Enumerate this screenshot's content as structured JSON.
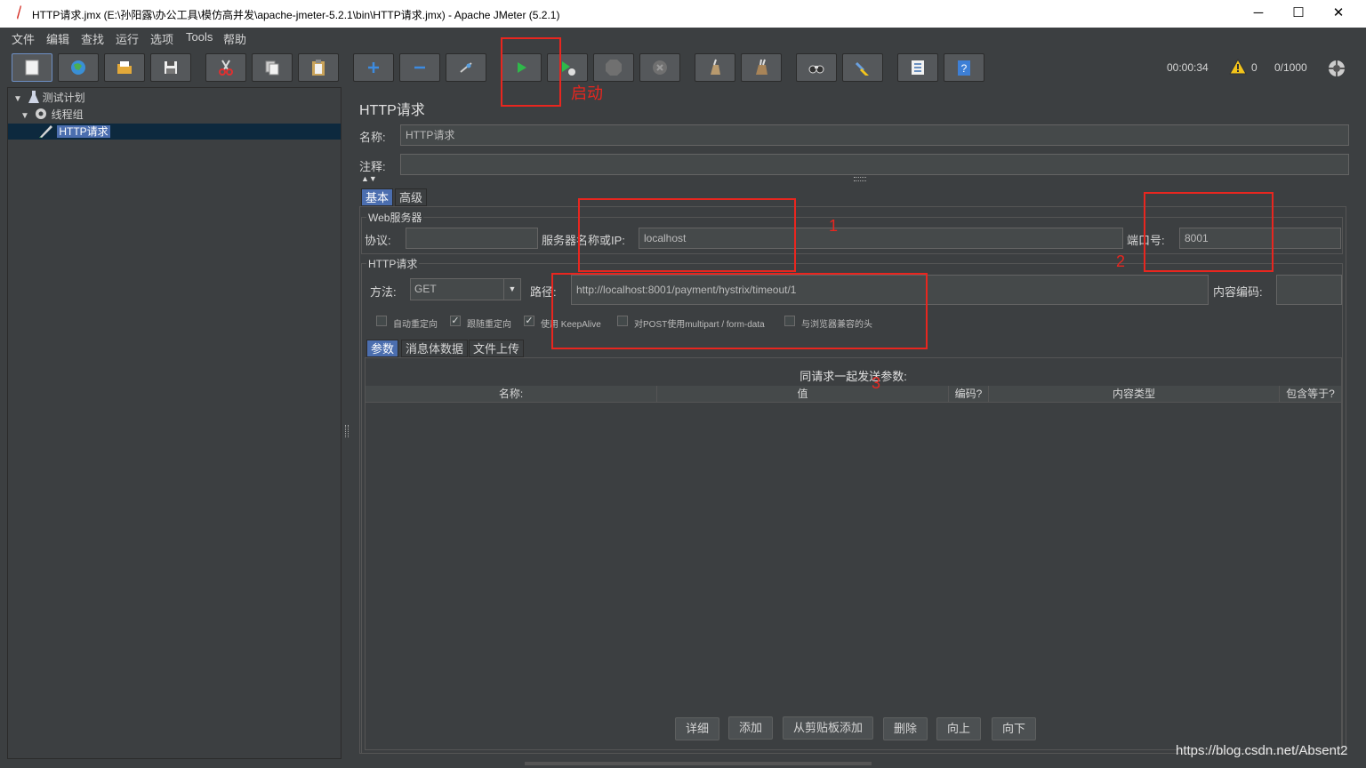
{
  "window": {
    "title": "HTTP请求.jmx (E:\\孙阳露\\办公工具\\模仿高并发\\apache-jmeter-5.2.1\\bin\\HTTP请求.jmx) - Apache JMeter (5.2.1)",
    "minimize": "─",
    "maximize": "☐",
    "close": "✕"
  },
  "menu": [
    "文件",
    "编辑",
    "查找",
    "运行",
    "选项",
    "Tools",
    "帮助"
  ],
  "toolbar": {
    "buttons": [
      "new-icon",
      "templates-icon",
      "open-icon",
      "save-icon",
      "cut-icon",
      "copy-icon",
      "paste-icon",
      "expand-icon",
      "collapse-icon",
      "toggle-icon",
      "start-icon",
      "start-no-pause-icon",
      "stop-icon",
      "shutdown-icon",
      "clear-icon",
      "clear-all-icon",
      "search-icon",
      "reset-search-icon",
      "function-helper-icon",
      "help-icon"
    ],
    "elapsed": "00:00:34",
    "warnings": "0",
    "threads": "0/1000"
  },
  "tree": {
    "items": [
      {
        "label": "测试计划"
      },
      {
        "label": "线程组"
      },
      {
        "label": "HTTP请求"
      }
    ]
  },
  "panel": {
    "title": "HTTP请求",
    "name_label": "名称:",
    "name_value": "HTTP请求",
    "comment_label": "注释:",
    "comment_value": "",
    "tabs": [
      "基本",
      "高级"
    ],
    "web_server": {
      "legend": "Web服务器",
      "protocol_label": "协议:",
      "protocol_value": "",
      "server_label": "服务器名称或IP:",
      "server_value": "localhost",
      "port_label": "端口号:",
      "port_value": "8001"
    },
    "http_request": {
      "legend": "HTTP请求",
      "method_label": "方法:",
      "method_value": "GET",
      "path_label": "路径:",
      "path_value": "http://localhost:8001/payment/hystrix/timeout/1",
      "encoding_label": "内容编码:",
      "encoding_value": "",
      "checkboxes": [
        {
          "label": "自动重定向",
          "checked": false
        },
        {
          "label": "跟随重定向",
          "checked": true
        },
        {
          "label": "使用 KeepAlive",
          "checked": true
        },
        {
          "label": "对POST使用multipart / form-data",
          "checked": false
        },
        {
          "label": "与浏览器兼容的头",
          "checked": false
        }
      ]
    },
    "sub_tabs": [
      "参数",
      "消息体数据",
      "文件上传"
    ],
    "params_title": "同请求一起发送参数:",
    "columns": [
      "名称:",
      "值",
      "编码?",
      "内容类型",
      "包含等于?"
    ],
    "buttons": [
      "详细",
      "添加",
      "从剪贴板添加",
      "删除",
      "向上",
      "向下"
    ]
  },
  "annotations": {
    "start_note": "启动",
    "mark1": "1",
    "mark2": "2",
    "mark3": "3"
  },
  "watermark": "https://blog.csdn.net/Absent2"
}
